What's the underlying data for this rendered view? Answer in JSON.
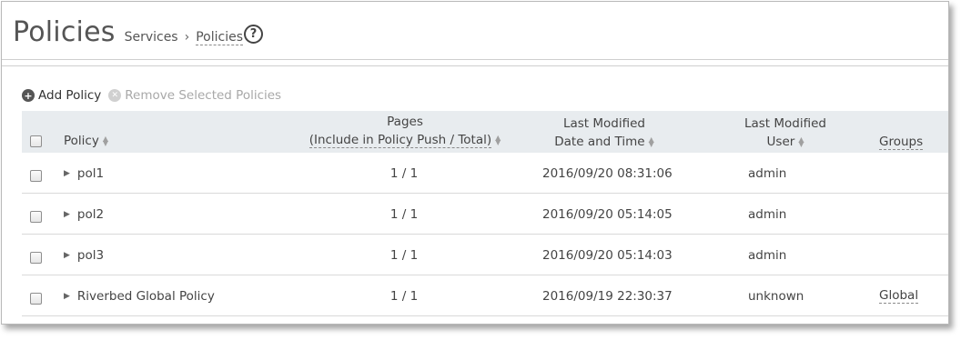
{
  "header": {
    "title": "Policies",
    "breadcrumb": {
      "parent": "Services",
      "separator": "›",
      "current": "Policies"
    },
    "help_icon": "question-circle-icon"
  },
  "toolbar": {
    "add_label": "Add Policy",
    "remove_label": "Remove Selected Policies"
  },
  "table": {
    "columns": {
      "policy": "Policy",
      "pages_line1": "Pages",
      "pages_line2": "(Include in Policy Push / Total)",
      "date_line1": "Last Modified",
      "date_line2": "Date and Time",
      "user_line1": "Last Modified",
      "user_line2": "User",
      "groups": "Groups"
    },
    "rows": [
      {
        "policy": "pol1",
        "pages": "1 / 1",
        "modified": "2016/09/20 08:31:06",
        "user": "admin",
        "groups": ""
      },
      {
        "policy": "pol2",
        "pages": "1 / 1",
        "modified": "2016/09/20 05:14:05",
        "user": "admin",
        "groups": ""
      },
      {
        "policy": "pol3",
        "pages": "1 / 1",
        "modified": "2016/09/20 05:14:03",
        "user": "admin",
        "groups": ""
      },
      {
        "policy": "Riverbed Global Policy",
        "pages": "1 / 1",
        "modified": "2016/09/19 22:30:37",
        "user": "unknown",
        "groups": "Global"
      }
    ]
  },
  "colors": {
    "header_bg": "#e8ecef",
    "row_border": "#d9d9d9",
    "disabled_text": "#a8a8a8"
  }
}
